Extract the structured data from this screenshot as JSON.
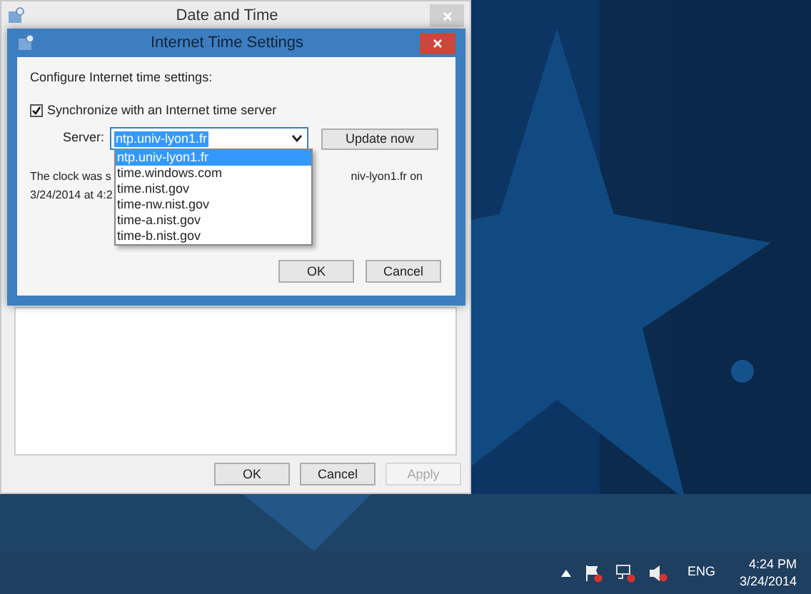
{
  "outer_window": {
    "title": "Date and Time",
    "buttons": [
      {
        "label": "OK",
        "disabled": false
      },
      {
        "label": "Cancel",
        "disabled": false
      },
      {
        "label": "Apply",
        "disabled": true
      }
    ]
  },
  "dialog": {
    "title": "Internet Time Settings",
    "heading": "Configure Internet time settings:",
    "sync": {
      "label": "Synchronize with an Internet time server",
      "checked": true
    },
    "server": {
      "label": "Server:",
      "value": "ntp.univ-lyon1.fr"
    },
    "update_button": "Update now",
    "status": {
      "line1_left": "The clock was s",
      "line1_right": "niv-lyon1.fr on",
      "line2_left": "3/24/2014 at 4:2"
    },
    "dropdown": [
      {
        "label": "ntp.univ-lyon1.fr",
        "selected": true
      },
      {
        "label": "time.windows.com",
        "selected": false
      },
      {
        "label": "time.nist.gov",
        "selected": false
      },
      {
        "label": "time-nw.nist.gov",
        "selected": false
      },
      {
        "label": "time-a.nist.gov",
        "selected": false
      },
      {
        "label": "time-b.nist.gov",
        "selected": false
      }
    ],
    "buttons": [
      "OK",
      "Cancel"
    ]
  },
  "taskbar": {
    "language": "ENG",
    "time": "4:24 PM",
    "date": "3/24/2014"
  }
}
